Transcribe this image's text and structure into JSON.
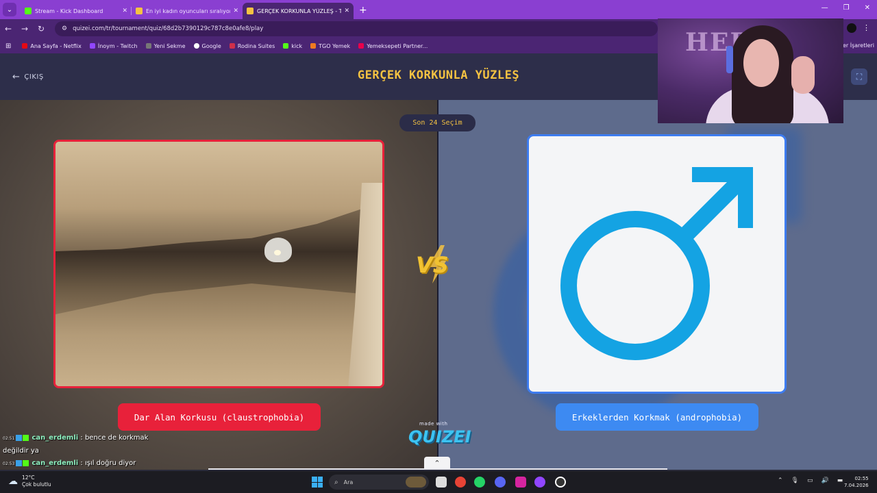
{
  "browser": {
    "tabs": [
      {
        "title": "Stream - Kick Dashboard",
        "active": false
      },
      {
        "title": "En iyi kadın oyuncuları sıralıyor",
        "active": false
      },
      {
        "title": "GERÇEK KORKUNLA YÜZLEŞ - T",
        "active": true
      }
    ],
    "url": "quizei.com/tr/tournament/quiz/68d2b7390129c787c8e0afe8/play",
    "bookmarks": [
      "Ana Sayfa - Netflix",
      "İnoym - Twitch",
      "Yeni Sekme",
      "Google",
      "Rodina Suites",
      "kick",
      "TGO Yemek",
      "Yemeksepeti Partner..."
    ],
    "bookmarks_right": "Yer İşaretleri"
  },
  "page": {
    "exit_label": "ÇIKIŞ",
    "title": "GERÇEK KORKUNLA YÜZLEŞ",
    "round_label": "Son 24 Seçim",
    "vs_label": "VS",
    "left_option": {
      "label": "Dar Alan Korkusu (claustrophobia)",
      "color": "#e8213a"
    },
    "right_option": {
      "label": "Erkeklerden Korkmak (androphobia)",
      "color": "#3d8af2"
    },
    "made_with": "made with",
    "brand": "QUIZEI"
  },
  "chat": [
    {
      "time": "02:51",
      "user": "can_erdemli",
      "message": ": bence de korkmak değildir ya"
    },
    {
      "time": "02:53",
      "user": "can_erdemli",
      "message": ": ışıl doğru diyor"
    }
  ],
  "webcam": {
    "overlay_logo": "HER"
  },
  "taskbar": {
    "weather_temp": "12°C",
    "weather_desc": "Çok bulutlu",
    "search_placeholder": "Ara",
    "time": "02:55",
    "date": "7.04.2026"
  },
  "colors": {
    "accent_title": "#f4c242",
    "tab_bar": "#8a3fd1",
    "page_bg": "#2d2e4a"
  }
}
